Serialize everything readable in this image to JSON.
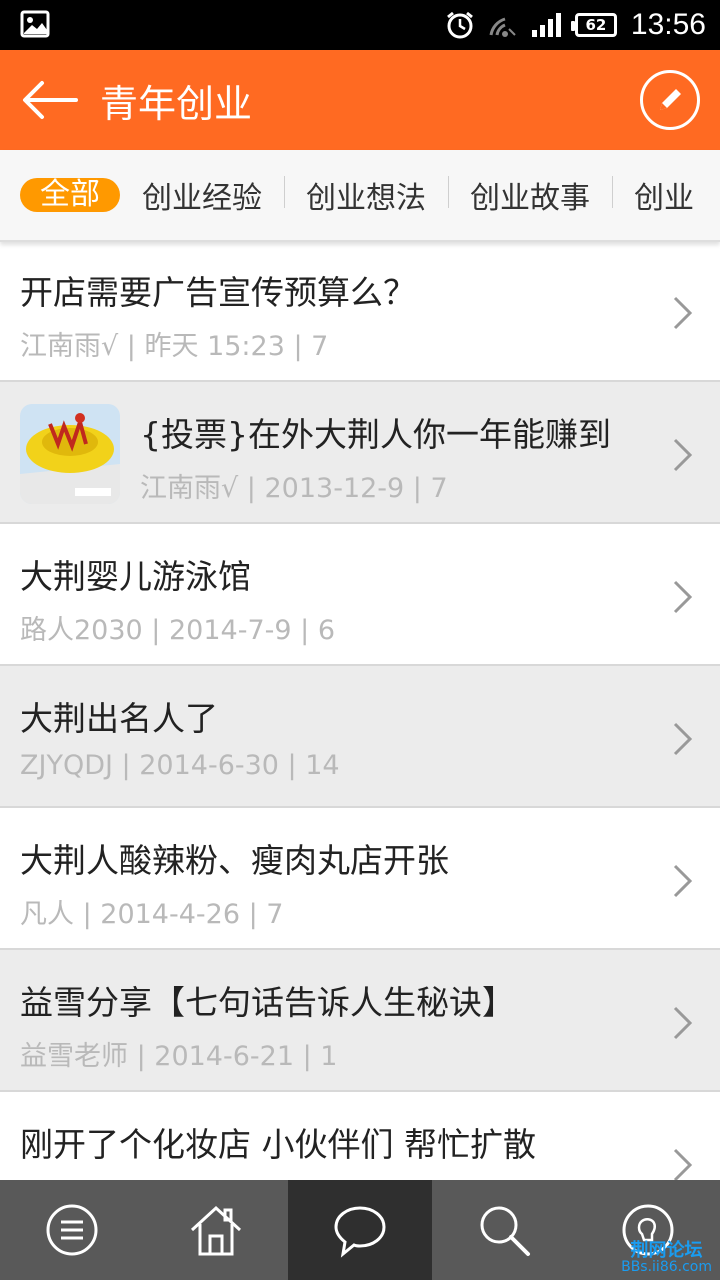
{
  "status_bar": {
    "time": "13:56",
    "battery": "62",
    "icons": [
      "image-icon",
      "alarm-icon",
      "wifi-icon",
      "signal-icon",
      "battery-icon"
    ]
  },
  "header": {
    "title": "青年创业",
    "color": "#ff6a22"
  },
  "categories": {
    "active_color": "#ff9900",
    "tabs": [
      {
        "label": "全部",
        "active": true
      },
      {
        "label": "创业经验",
        "active": false
      },
      {
        "label": "创业想法",
        "active": false
      },
      {
        "label": "创业故事",
        "active": false
      },
      {
        "label": "创业",
        "active": false
      }
    ]
  },
  "posts": [
    {
      "title": "开店需要广告宣传预算么？",
      "author": "江南雨√",
      "sep1": " | ",
      "date": "昨天 15:23",
      "sep2": " | ",
      "replies": "7"
    },
    {
      "title": "{投票}在外大荆人你一年能赚到",
      "author": "江南雨√",
      "sep1": " | ",
      "date": "2013-12-9",
      "sep2": " | ",
      "replies": "7",
      "thumbnail": true
    },
    {
      "title": "大荆婴儿游泳馆",
      "author": "路人2030",
      "sep1": " | ",
      "date": "2014-7-9",
      "sep2": " | ",
      "replies": "6"
    },
    {
      "title": "大荆出名人了",
      "author": "ZJYQDJ",
      "sep1": " | ",
      "date": "2014-6-30",
      "sep2": " | ",
      "replies": "14"
    },
    {
      "title": "大荆人酸辣粉、瘦肉丸店开张",
      "author": "凡人",
      "sep1": " | ",
      "date": "2014-4-26",
      "sep2": " | ",
      "replies": "7"
    },
    {
      "title": "益雪分享【七句话告诉人生秘诀】",
      "author": "益雪老师",
      "sep1": " | ",
      "date": "2014-6-21",
      "sep2": " | ",
      "replies": "1"
    },
    {
      "title": "刚开了个化妆店 小伙伴们 帮忙扩散",
      "author": "",
      "sep1": "",
      "date": "",
      "sep2": "",
      "replies": ""
    }
  ],
  "bottom_nav": {
    "items": [
      "menu-icon",
      "home-icon",
      "chat-icon",
      "search-icon",
      "bulb-icon"
    ],
    "active_index": 2
  },
  "watermark": {
    "line1": "荆网论坛",
    "line2": "BBs.ii86.com"
  }
}
